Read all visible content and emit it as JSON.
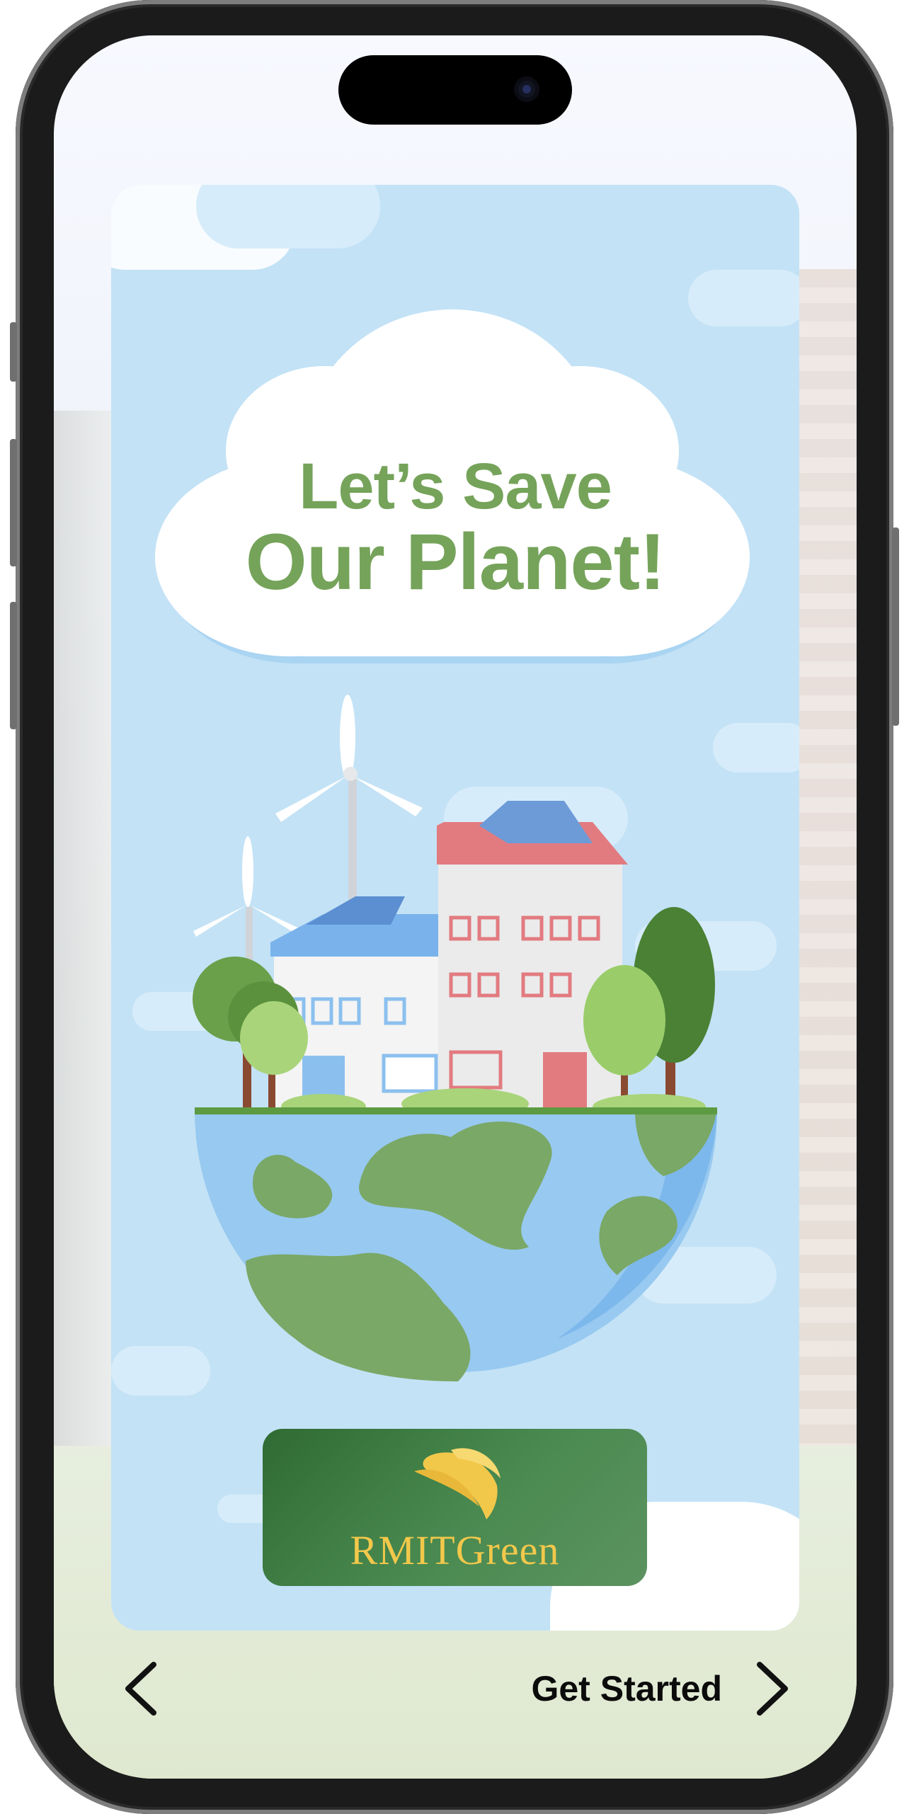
{
  "onboarding": {
    "headline_line1": "Let’s Save",
    "headline_line2": "Our Planet!",
    "brand_name": "RMITGreen",
    "next_label": "Get Started"
  },
  "icons": {
    "back": "chevron-left-icon",
    "next": "chevron-right-icon",
    "brand": "leaf-icon"
  },
  "colors": {
    "card_background": "#c3e2f6",
    "headline": "#75a35a",
    "brand_background": "#3f7d44",
    "brand_text": "#f2c84b"
  }
}
